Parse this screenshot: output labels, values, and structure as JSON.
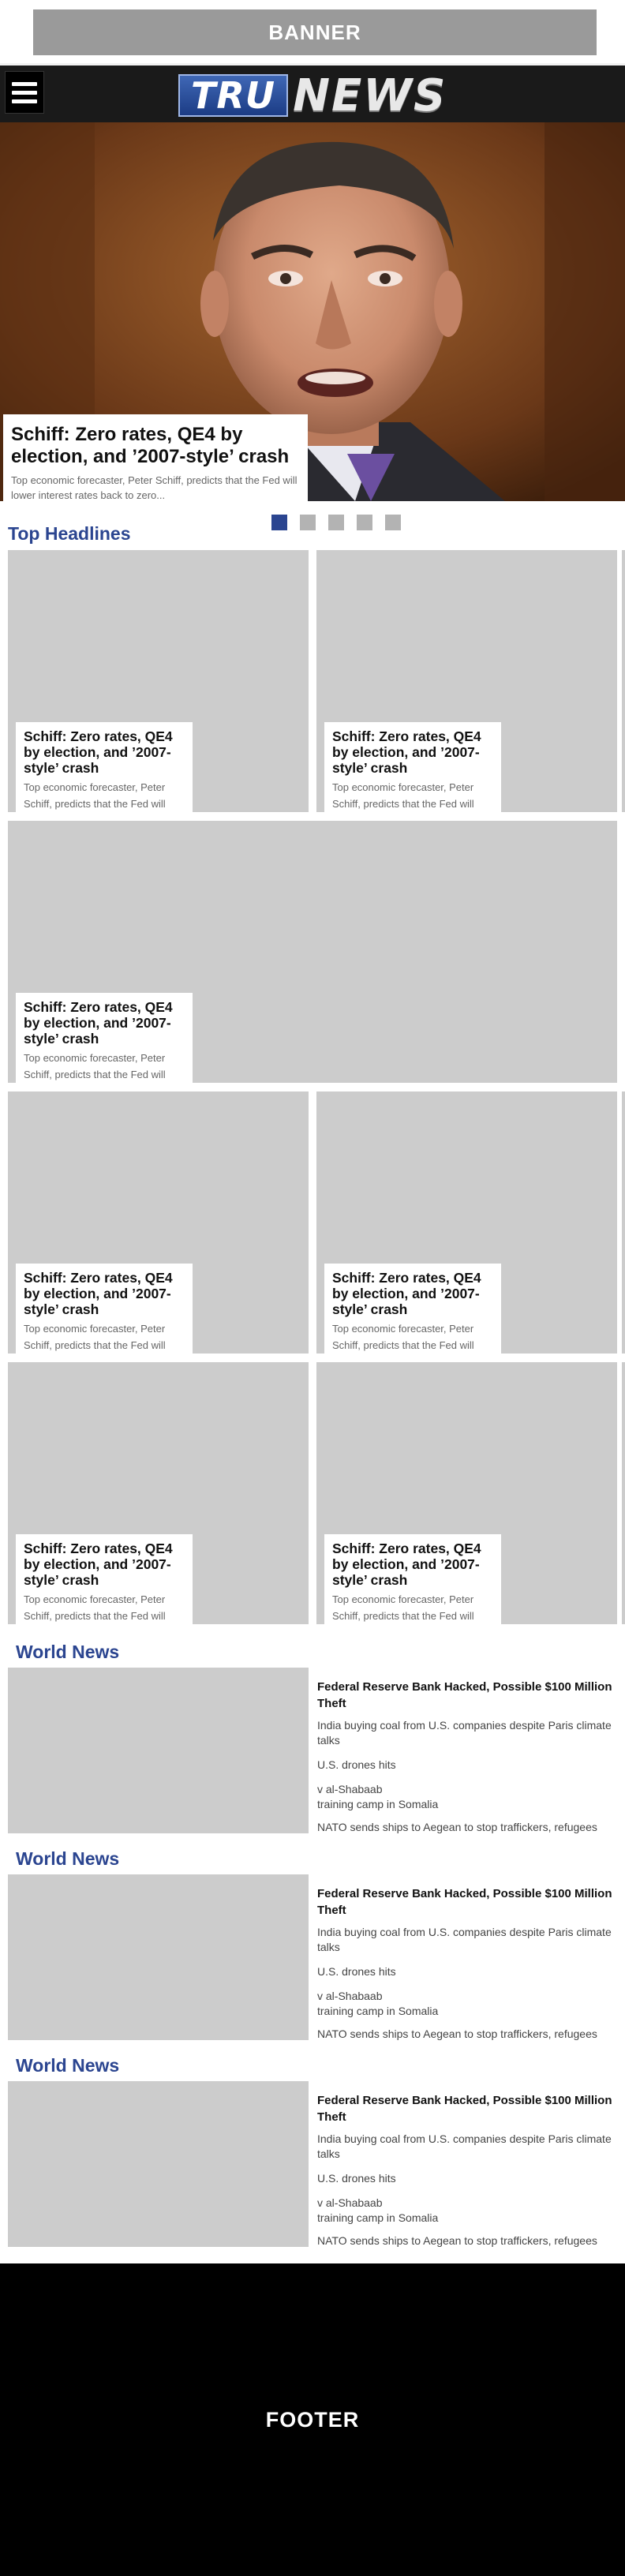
{
  "banner": {
    "label": "BANNER"
  },
  "nav": {
    "logo_tru": "TRU",
    "logo_news": "NEWS"
  },
  "hero": {
    "title": "Schiff: Zero rates, QE4 by election, and ’2007-style’ crash",
    "desc": "Top economic forecaster, Peter Schiff, predicts that the Fed will lower interest rates back to zero...",
    "slide_count": 5,
    "active_slide": 1
  },
  "top_headlines": {
    "heading": "Top Headlines",
    "cards": [
      {
        "title": "Schiff: Zero rates, QE4 by election, and ’2007-style’ crash",
        "desc": "Top economic forecaster, Peter Schiff, predicts that the Fed will"
      },
      {
        "title": "Schiff: Zero rates, QE4 by election, and ’2007-style’ crash",
        "desc": "Top economic forecaster, Peter Schiff, predicts that the Fed will"
      },
      {
        "title": "Schiff: Zero rates, QE4 by election, and ’2007-style’ crash",
        "desc": "Top economic forecaster, Peter Schiff, predicts that the Fed will"
      },
      {
        "title": "Schiff: Zero rates, QE4 by election, and ’2007-style’ crash",
        "desc": "Top economic forecaster, Peter Schiff, predicts that the Fed will"
      },
      {
        "title": "Schiff: Zero rates, QE4 by election, and ’2007-style’ crash",
        "desc": "Top economic forecaster, Peter Schiff, predicts that the Fed will"
      },
      {
        "title": "Schiff: Zero rates, QE4 by election, and ’2007-style’ crash",
        "desc": "Top economic forecaster, Peter Schiff, predicts that the Fed will"
      },
      {
        "title": "Schiff: Zero rates, QE4 by election, and ’2007-style’ crash",
        "desc": "Top economic forecaster, Peter Schiff, predicts that the Fed will"
      }
    ]
  },
  "world_news": [
    {
      "heading": "World News",
      "headline": "Federal Reserve Bank Hacked, Possible $100 Million Theft",
      "items": [
        "India buying coal from U.S.  companies despite Paris climate talks",
        "U.S. drones hits",
        "v al-Shabaab\ntraining camp in Somalia",
        "NATO sends ships to  Aegean to stop traffickers, refugees"
      ]
    },
    {
      "heading": "World News",
      "headline": "Federal Reserve Bank Hacked, Possible $100 Million Theft",
      "items": [
        "India buying coal from U.S.  companies despite Paris climate talks",
        "U.S. drones hits",
        "v al-Shabaab\ntraining camp in Somalia",
        "NATO sends ships to  Aegean to stop traffickers, refugees"
      ]
    },
    {
      "heading": "World News",
      "headline": "Federal Reserve Bank Hacked, Possible $100 Million Theft",
      "items": [
        "India buying coal from U.S.  companies despite Paris climate talks",
        "U.S. drones hits",
        "v al-Shabaab\ntraining camp in Somalia",
        "NATO sends ships to  Aegean to stop traffickers, refugees"
      ]
    }
  ],
  "footer": {
    "label": "FOOTER"
  },
  "colors": {
    "accent": "#2b4590",
    "placeholder": "#cccccc",
    "nav_bg": "#1a1a1a",
    "footer_bg": "#000000"
  }
}
